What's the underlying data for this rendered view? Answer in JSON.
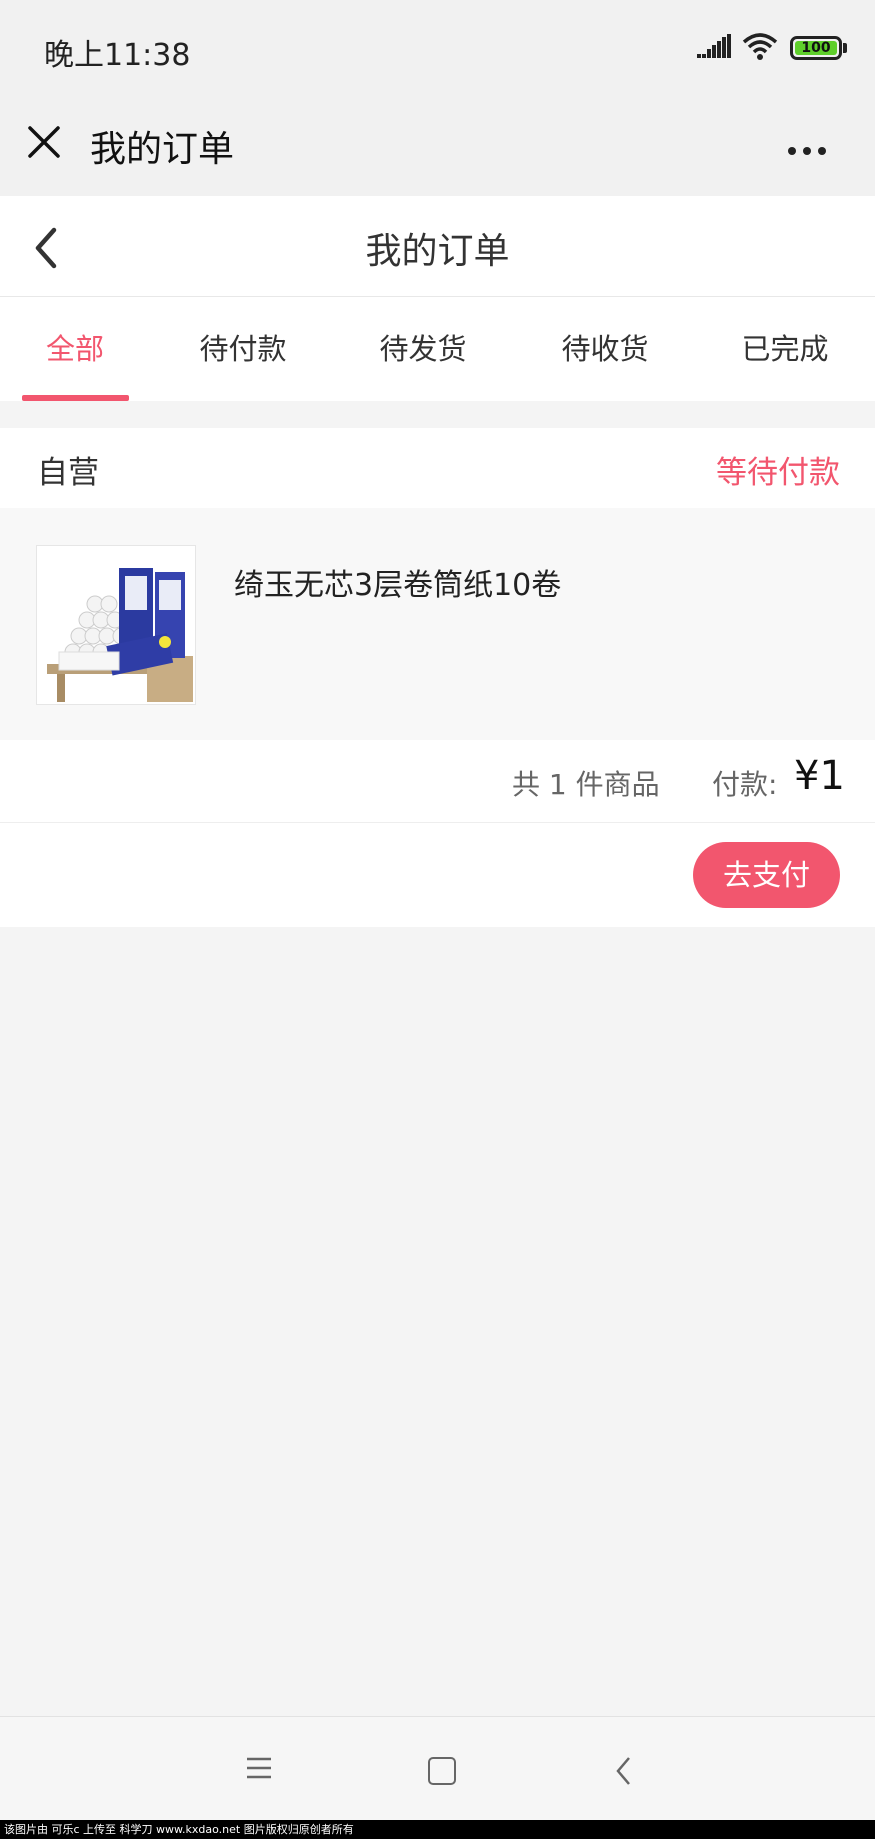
{
  "status_bar": {
    "time": "晚上11:38",
    "battery": "100",
    "icons": [
      "signal-icon",
      "wifi-icon",
      "battery-icon"
    ]
  },
  "wechat_bar": {
    "title": "我的订单",
    "close_icon": "close-icon",
    "more_icon": "more-icon"
  },
  "header": {
    "title": "我的订单",
    "back_icon": "chevron-left-icon"
  },
  "tabs": [
    {
      "label": "全部",
      "active": true
    },
    {
      "label": "待付款",
      "active": false
    },
    {
      "label": "待发货",
      "active": false
    },
    {
      "label": "待收货",
      "active": false
    },
    {
      "label": "已完成",
      "active": false
    }
  ],
  "order": {
    "shop": "自营",
    "status": "等待付款",
    "item": {
      "name": "绮玉无芯3层卷筒纸10卷"
    },
    "count_text": "共 1 件商品",
    "pay_label": "付款:",
    "pay_amount": "¥1",
    "pay_button": "去支付"
  },
  "nav": {
    "icons": [
      "menu-icon",
      "home-icon",
      "back-icon"
    ]
  },
  "watermark": "该图片由 可乐c 上传至 科学刀 www.kxdao.net 图片版权归原创者所有",
  "colors": {
    "accent": "#f2566e",
    "background": "#f4f4f4"
  }
}
